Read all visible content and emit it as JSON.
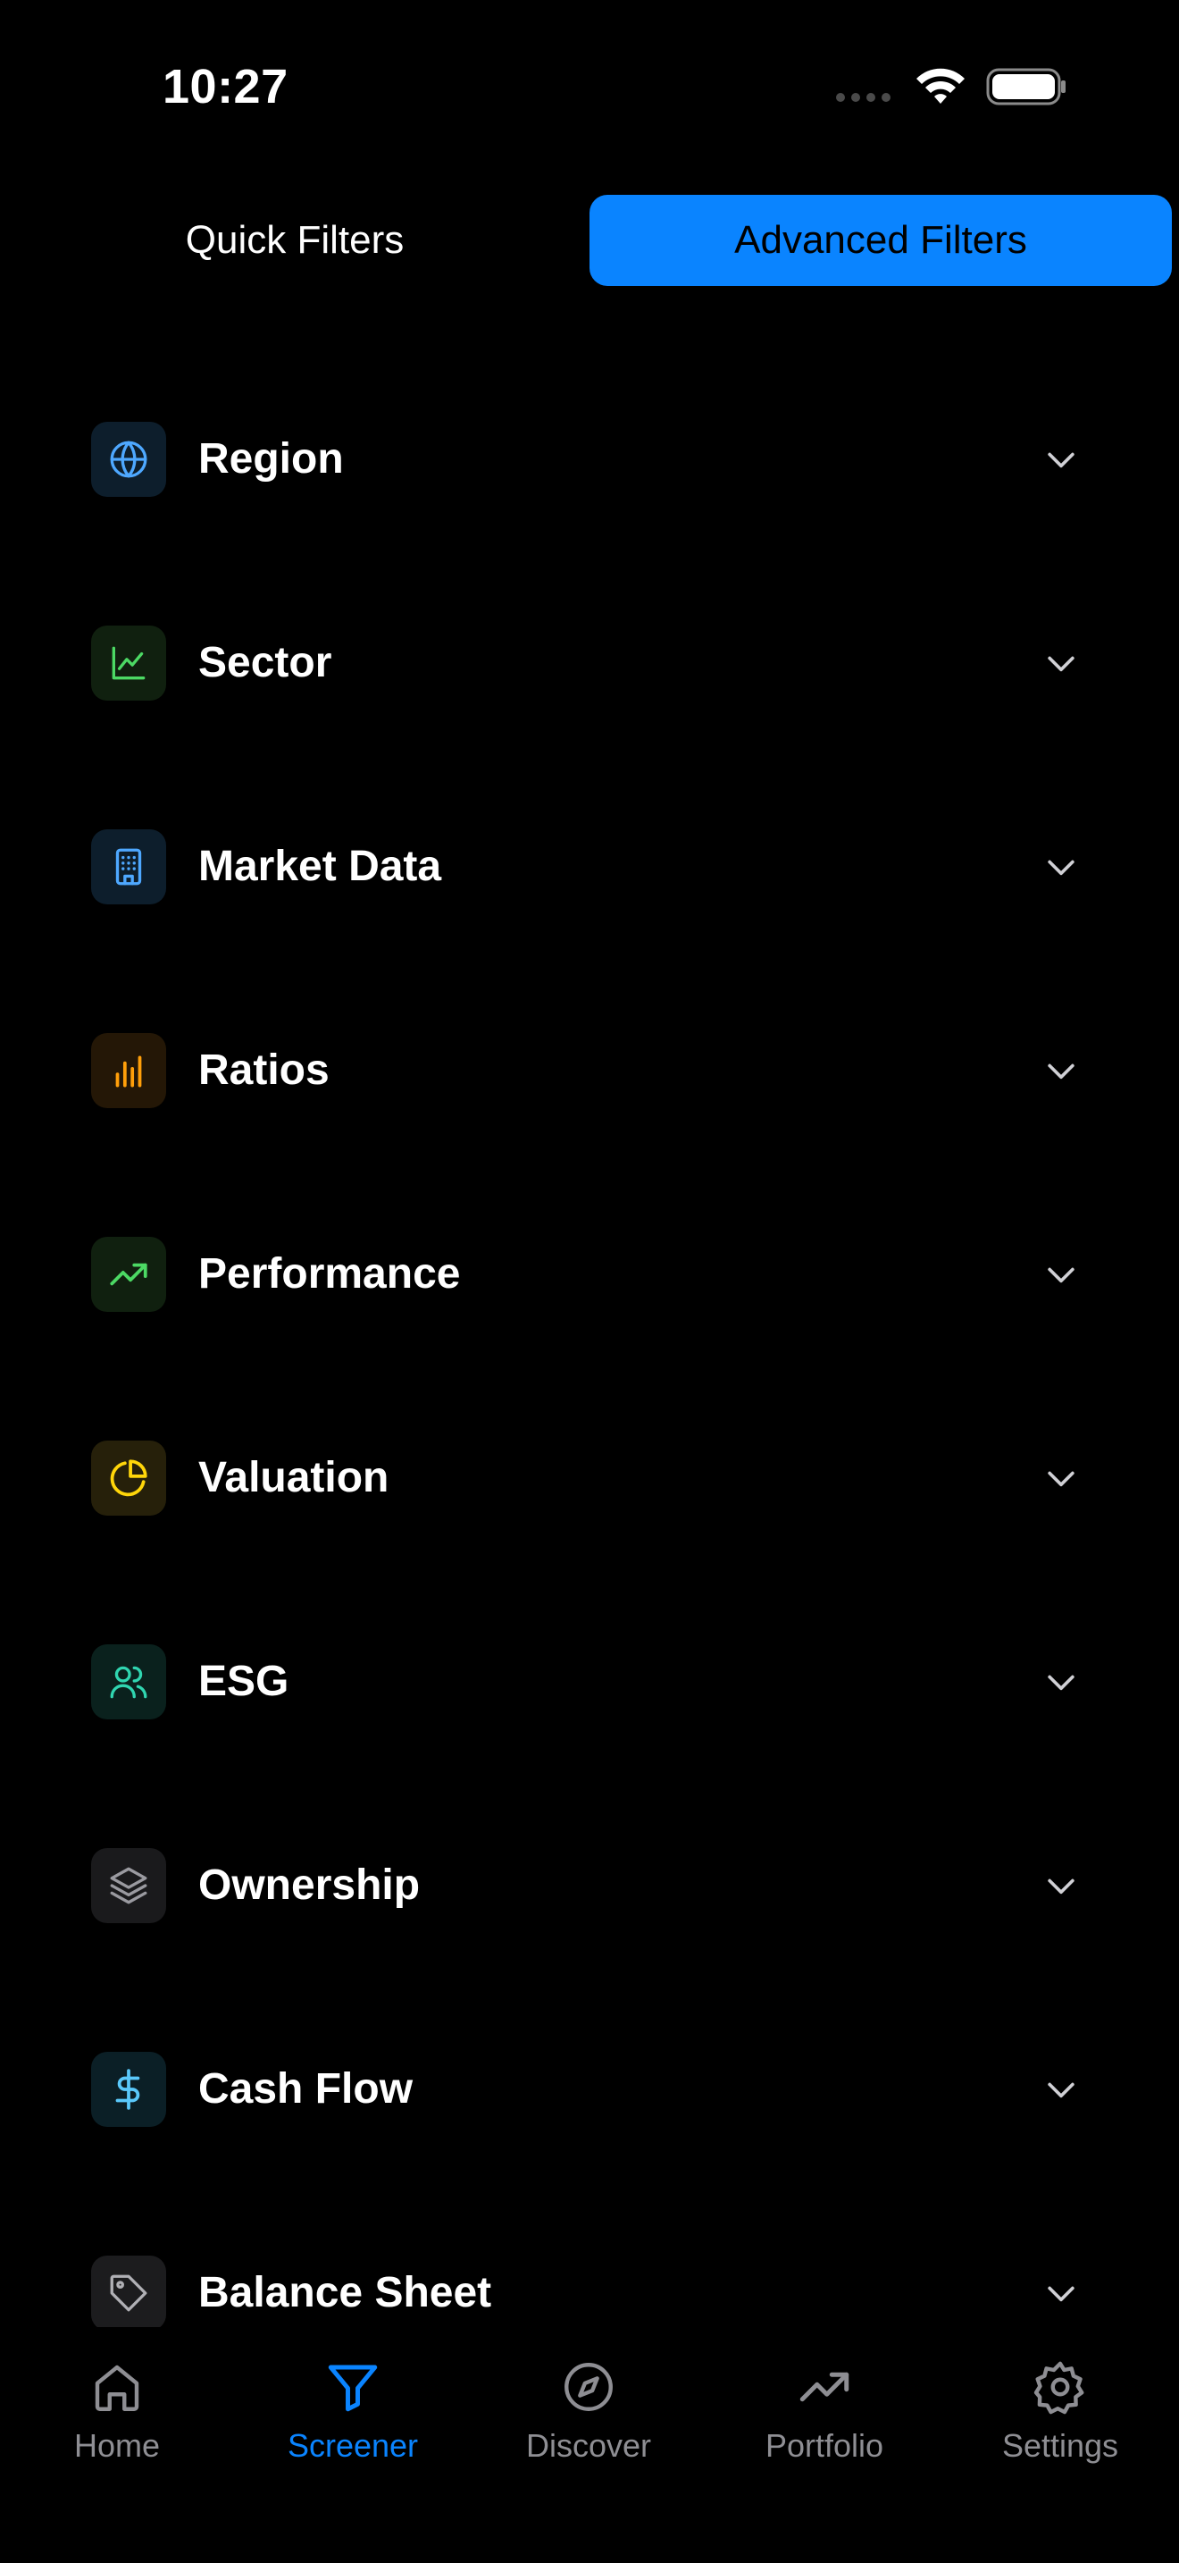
{
  "status_bar": {
    "time": "10:27"
  },
  "segmented": {
    "quick_label": "Quick Filters",
    "advanced_label": "Advanced Filters",
    "selected": "Advanced Filters"
  },
  "filters": [
    {
      "label": "Region",
      "icon": "globe-icon",
      "color": "#4ea8ff"
    },
    {
      "label": "Sector",
      "icon": "line-chart-icon",
      "color": "#4cd964"
    },
    {
      "label": "Market Data",
      "icon": "building-icon",
      "color": "#4ea8ff"
    },
    {
      "label": "Ratios",
      "icon": "bar-chart-icon",
      "color": "#ff9f0a"
    },
    {
      "label": "Performance",
      "icon": "trending-up-icon",
      "color": "#4cd964"
    },
    {
      "label": "Valuation",
      "icon": "pie-chart-icon",
      "color": "#ffd60a"
    },
    {
      "label": "ESG",
      "icon": "users-icon",
      "color": "#30d5b0"
    },
    {
      "label": "Ownership",
      "icon": "layers-icon",
      "color": "#9a9aa0"
    },
    {
      "label": "Cash Flow",
      "icon": "dollar-icon",
      "color": "#5ac8fa"
    },
    {
      "label": "Balance Sheet",
      "icon": "tag-icon",
      "color": "#b0b0b5"
    }
  ],
  "tab_bar": {
    "items": [
      {
        "label": "Home",
        "icon": "home-icon"
      },
      {
        "label": "Screener",
        "icon": "filter-icon"
      },
      {
        "label": "Discover",
        "icon": "compass-icon"
      },
      {
        "label": "Portfolio",
        "icon": "trending-up-icon"
      },
      {
        "label": "Settings",
        "icon": "gear-icon"
      }
    ],
    "active": "Screener"
  },
  "colors": {
    "accent": "#0a84ff",
    "background": "#000000",
    "inactive_tab": "#8e8e93"
  }
}
